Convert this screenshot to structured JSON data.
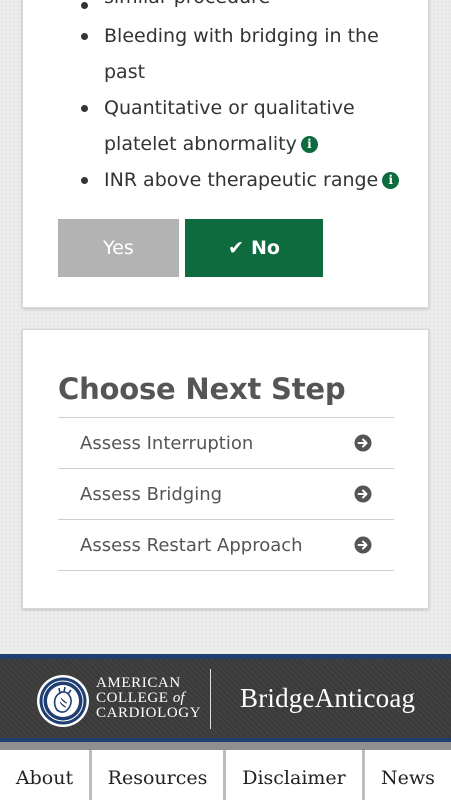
{
  "criteria_card": {
    "criteria": [
      {
        "text": "similar procedure",
        "has_info": false
      },
      {
        "text": "Bleeding with bridging in the past",
        "has_info": false
      },
      {
        "text": "Quantitative or qualitative platelet abnormality",
        "has_info": true
      },
      {
        "text": "INR above therapeutic range",
        "has_info": true
      }
    ],
    "info_icon_glyph": "i",
    "yes_label": "Yes",
    "no_label": "No",
    "no_selected": true,
    "check_icon_glyph": "✔"
  },
  "next_step": {
    "title": "Choose Next Step",
    "items": [
      {
        "label": "Assess Interruption",
        "icon": "arrow-circle-right-icon"
      },
      {
        "label": "Assess Bridging",
        "icon": "arrow-circle-right-icon"
      },
      {
        "label": "Assess Restart Approach",
        "icon": "arrow-circle-right-icon"
      }
    ]
  },
  "footer": {
    "org_line1": "AMERICAN",
    "org_line2a": "COLLEGE",
    "org_line2b": "of",
    "org_line3": "CARDIOLOGY",
    "product_name": "BridgeAnticoag",
    "nav": [
      "About",
      "Resources",
      "Disclaimer",
      "News"
    ]
  },
  "colors": {
    "accent_green": "#0d6b3e",
    "button_gray": "#b3b3b3",
    "footer_blue": "#1f3f73",
    "text_dark": "#333333"
  }
}
